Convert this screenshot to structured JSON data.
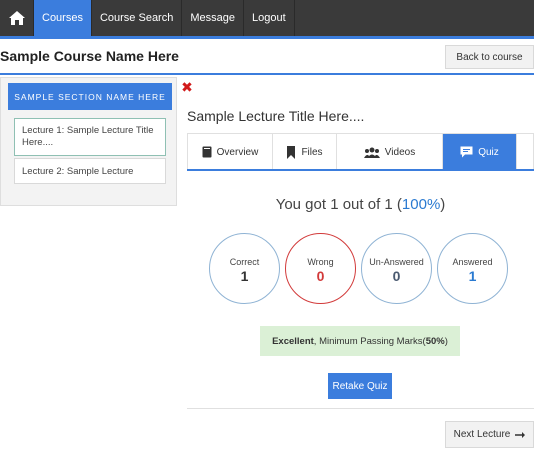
{
  "colors": {
    "accent": "#3b7ddd",
    "navbar": "#3a3a3a",
    "wrong": "#d23a3a",
    "answered": "#2a7ad1",
    "success_bg": "#dbf0d6"
  },
  "nav": {
    "home_icon": "home-icon",
    "items": [
      {
        "label": "Courses",
        "active": true
      },
      {
        "label": "Course Search",
        "active": false
      },
      {
        "label": "Message",
        "active": false
      },
      {
        "label": "Logout",
        "active": false
      }
    ]
  },
  "header": {
    "course_title": "Sample Course Name Here",
    "back_label": "Back to course"
  },
  "sidebar": {
    "section_name": "SAMPLE SECTION NAME HERE",
    "lectures": [
      {
        "label": "Lecture 1: Sample Lecture Title Here....",
        "selected": true
      },
      {
        "label": "Lecture 2: Sample Lecture",
        "selected": false
      }
    ]
  },
  "close_icon": "close-icon",
  "lecture": {
    "title": "Sample Lecture Title Here...."
  },
  "tabs": [
    {
      "label": "Overview",
      "icon": "book-icon",
      "active": false
    },
    {
      "label": "Files",
      "icon": "bookmark-icon",
      "active": false
    },
    {
      "label": "Videos",
      "icon": "users-icon",
      "active": false
    },
    {
      "label": "Quiz",
      "icon": "chat-icon",
      "active": true
    }
  ],
  "quiz": {
    "score_prefix": "You got 1 out of 1 (",
    "score_percent": "100%",
    "score_suffix": ")",
    "stats": [
      {
        "label": "Correct",
        "value": "1",
        "color": "#333333"
      },
      {
        "label": "Wrong",
        "value": "0",
        "color": "#d23a3a"
      },
      {
        "label": "Un-Answered",
        "value": "0",
        "color": "#4a5a70"
      },
      {
        "label": "Answered",
        "value": "1",
        "color": "#2a7ad1"
      }
    ],
    "result_strong": "Excellent",
    "result_text": ", Minimum Passing Marks(",
    "result_marks": "50%",
    "result_close": ")",
    "retake_label": "Retake Quiz"
  },
  "footer": {
    "next_label": "Next Lecture",
    "next_icon": "arrow-right-icon"
  }
}
